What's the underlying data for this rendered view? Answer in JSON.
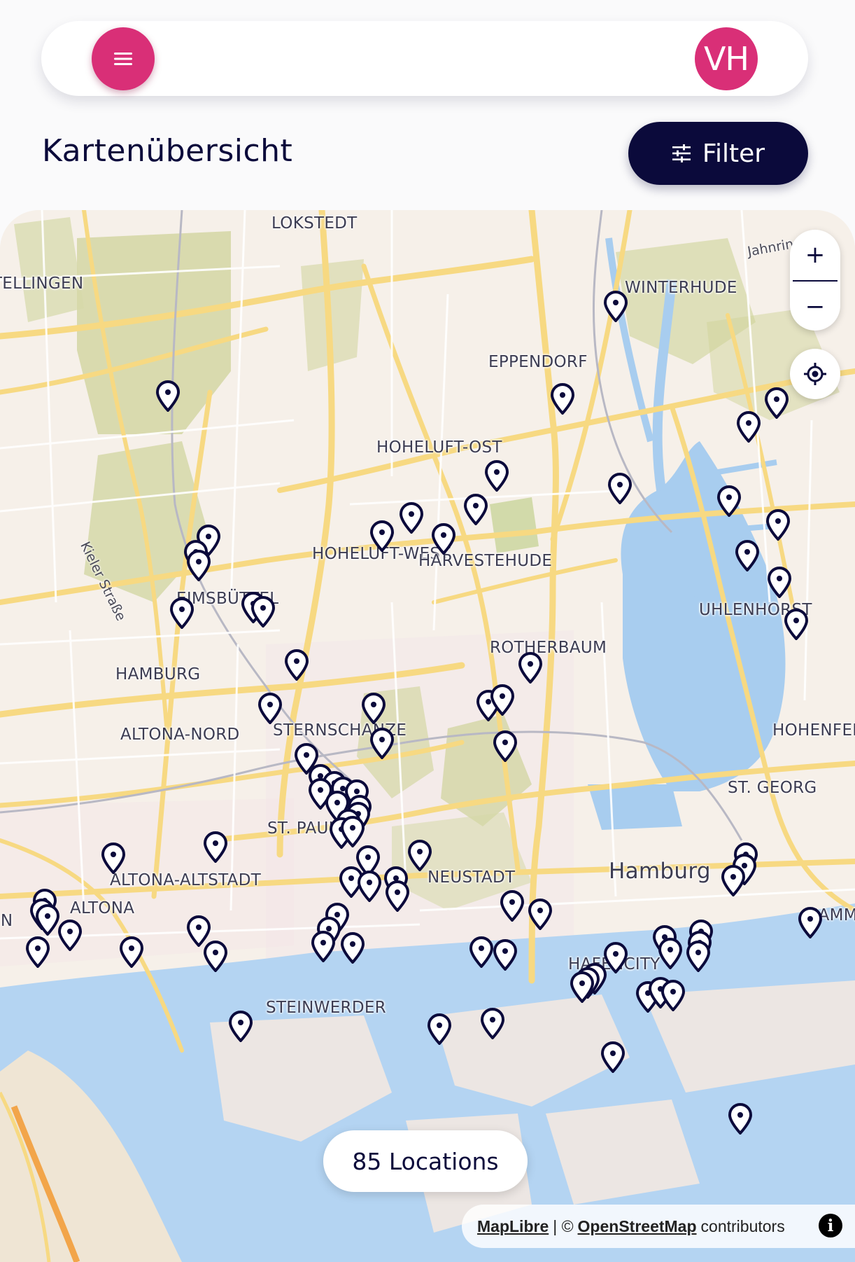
{
  "header": {
    "menu_icon": "hamburger-menu-icon",
    "avatar_initials": "VH"
  },
  "page_title": "Kartenübersicht",
  "filter_button": {
    "label": "Filter",
    "icon": "sliders-icon"
  },
  "map": {
    "place_labels": [
      "LOKSTEDT",
      "STELLINGEN",
      "WINTERHUDE",
      "EPPENDORF",
      "HOHELUFT-OST",
      "HOHELUFT-WEST",
      "HARVESTEHUDE",
      "EIMSBÜTTEL",
      "UHLENHORST",
      "ROTHERBAUM",
      "HAMBURG",
      "ALTONA-NORD",
      "STERNSCHANZE",
      "HOHENFELDE",
      "ST. GEORG",
      "ST. PAULI",
      "ALTONA-ALTSTADT",
      "NEUSTADT",
      "Hamburg",
      "ALTONA",
      "HAFENCITY",
      "STEINWERDER",
      "HAMM",
      "EN"
    ],
    "street_labels": [
      "Kieler Straße",
      "Jahnring"
    ],
    "zoom_in_label": "+",
    "zoom_out_label": "−",
    "locate_icon": "crosshair-locate-icon",
    "pin_icon": "map-pin-icon",
    "location_count_label": "85 Locations",
    "attribution": {
      "maplibre": "MapLibre",
      "separator": "| ©",
      "osm": "OpenStreetMap",
      "contributors": "contributors",
      "info_icon": "info-icon"
    }
  },
  "colors": {
    "accent": "#d92f77",
    "navy": "#0b0a3b",
    "water": "#a8cdef",
    "park": "#cfd39a",
    "road": "#f7d982"
  }
}
